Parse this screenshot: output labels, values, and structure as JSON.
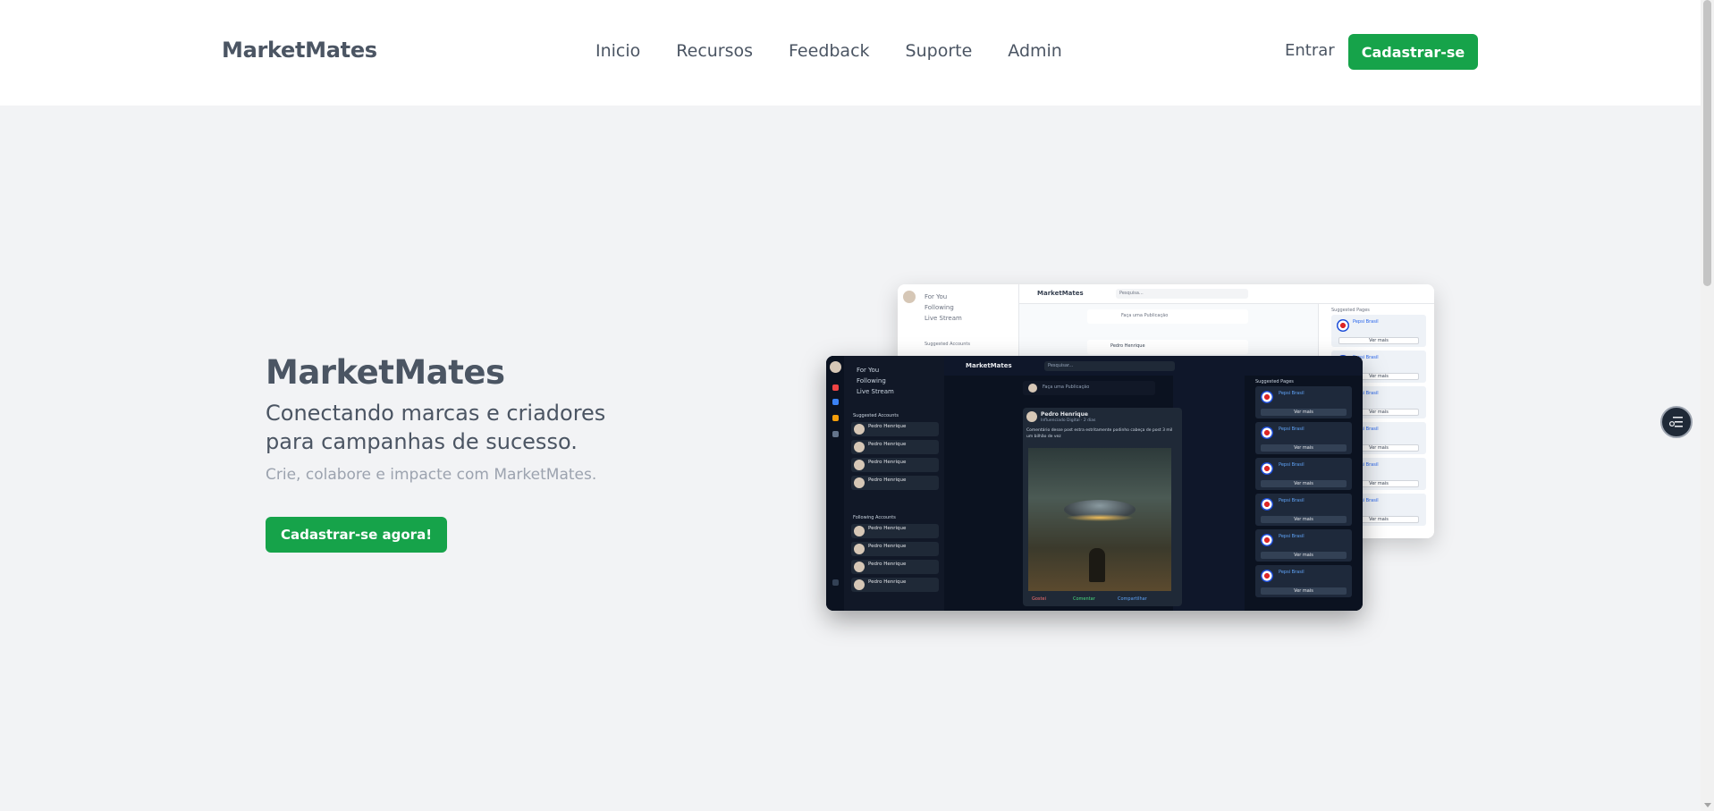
{
  "header": {
    "logo": "MarketMates",
    "nav": [
      "Inicio",
      "Recursos",
      "Feedback",
      "Suporte",
      "Admin"
    ],
    "login": "Entrar",
    "signup": "Cadastrar-se"
  },
  "hero": {
    "title": "MarketMates",
    "subtitle": "Conectando marcas e criadores para campanhas de sucesso.",
    "description": "Crie, colabore e impacte com MarketMates.",
    "cta": "Cadastrar-se agora!"
  },
  "mock_light": {
    "brand": "MarketMates",
    "search_placeholder": "Pesquisa...",
    "menu": [
      "For You",
      "Following",
      "Live Stream"
    ],
    "suggested_accounts": "Suggested Accounts",
    "compose": "Faça uma Publicação",
    "post_author": "Pedro Henrique",
    "suggested_pages": "Suggested Pages",
    "page_name": "Pepsi Brasil",
    "view_more": "Ver mais"
  },
  "mock_dark": {
    "brand": "MarketMates",
    "search_placeholder": "Pesquisar...",
    "menu": [
      "For You",
      "Following",
      "Live Stream"
    ],
    "suggested_accounts": "Suggested Accounts",
    "following_accounts": "Following Accounts",
    "account_name": "Pedro Henrique",
    "compose": "Faça uma Publicação",
    "post_author": "Pedro Henrique",
    "post_meta": "Influenciado Digital · 2 dias",
    "post_text": "Comentário desse post estra estritamente podinho cabeça de post 3 mil um bilhão de vez",
    "actions": [
      "Gostei",
      "Comentar",
      "Compartilhar"
    ],
    "suggested_pages": "Suggested Pages",
    "page_name": "Pepsi Brasil",
    "view_more": "Ver mais"
  }
}
